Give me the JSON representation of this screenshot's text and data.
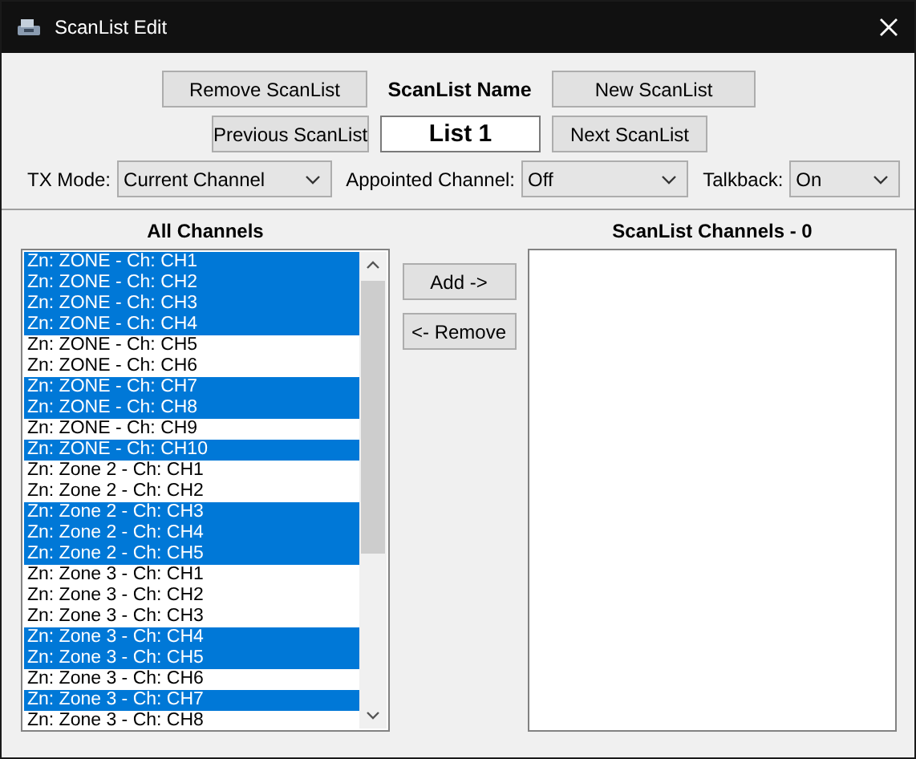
{
  "window": {
    "title": "ScanList Edit"
  },
  "remove_button": "Remove ScanList",
  "name_label": "ScanList Name",
  "new_button": "New ScanList",
  "previous_button": "Previous ScanList",
  "name_field": {
    "value": "List 1"
  },
  "next_button": "Next ScanList",
  "settings": [
    {
      "label": "TX Mode:",
      "value": "Current Channel"
    },
    {
      "label": "Appointed Channel:",
      "value": "Off"
    },
    {
      "label": "Talkback:",
      "value": "On"
    }
  ],
  "all_channels": {
    "heading": "All Channels",
    "items": [
      {
        "label": "Zn: ZONE - Ch: CH1",
        "selected": true
      },
      {
        "label": "Zn: ZONE - Ch: CH2",
        "selected": true
      },
      {
        "label": "Zn: ZONE - Ch: CH3",
        "selected": true
      },
      {
        "label": "Zn: ZONE - Ch: CH4",
        "selected": true
      },
      {
        "label": "Zn: ZONE - Ch: CH5",
        "selected": false
      },
      {
        "label": "Zn: ZONE - Ch: CH6",
        "selected": false
      },
      {
        "label": "Zn: ZONE - Ch: CH7",
        "selected": true
      },
      {
        "label": "Zn: ZONE - Ch: CH8",
        "selected": true
      },
      {
        "label": "Zn: ZONE - Ch: CH9",
        "selected": false
      },
      {
        "label": "Zn: ZONE - Ch: CH10",
        "selected": true
      },
      {
        "label": "Zn: Zone 2 - Ch: CH1",
        "selected": false
      },
      {
        "label": "Zn: Zone 2 - Ch: CH2",
        "selected": false
      },
      {
        "label": "Zn: Zone 2 - Ch: CH3",
        "selected": true
      },
      {
        "label": "Zn: Zone 2 - Ch: CH4",
        "selected": true
      },
      {
        "label": "Zn: Zone 2 - Ch: CH5",
        "selected": true
      },
      {
        "label": "Zn: Zone 3 - Ch: CH1",
        "selected": false
      },
      {
        "label": "Zn: Zone 3 - Ch: CH2",
        "selected": false
      },
      {
        "label": "Zn: Zone 3 - Ch: CH3",
        "selected": false
      },
      {
        "label": "Zn: Zone 3 - Ch: CH4",
        "selected": true
      },
      {
        "label": "Zn: Zone 3 - Ch: CH5",
        "selected": true
      },
      {
        "label": "Zn: Zone 3 - Ch: CH6",
        "selected": false
      },
      {
        "label": "Zn: Zone 3 - Ch: CH7",
        "selected": true
      },
      {
        "label": "Zn: Zone 3 - Ch: CH8",
        "selected": false
      }
    ]
  },
  "add_button": "Add ->",
  "remove_channel_button": "<- Remove",
  "scanlist_channels": {
    "heading": "ScanList Channels - 0"
  }
}
